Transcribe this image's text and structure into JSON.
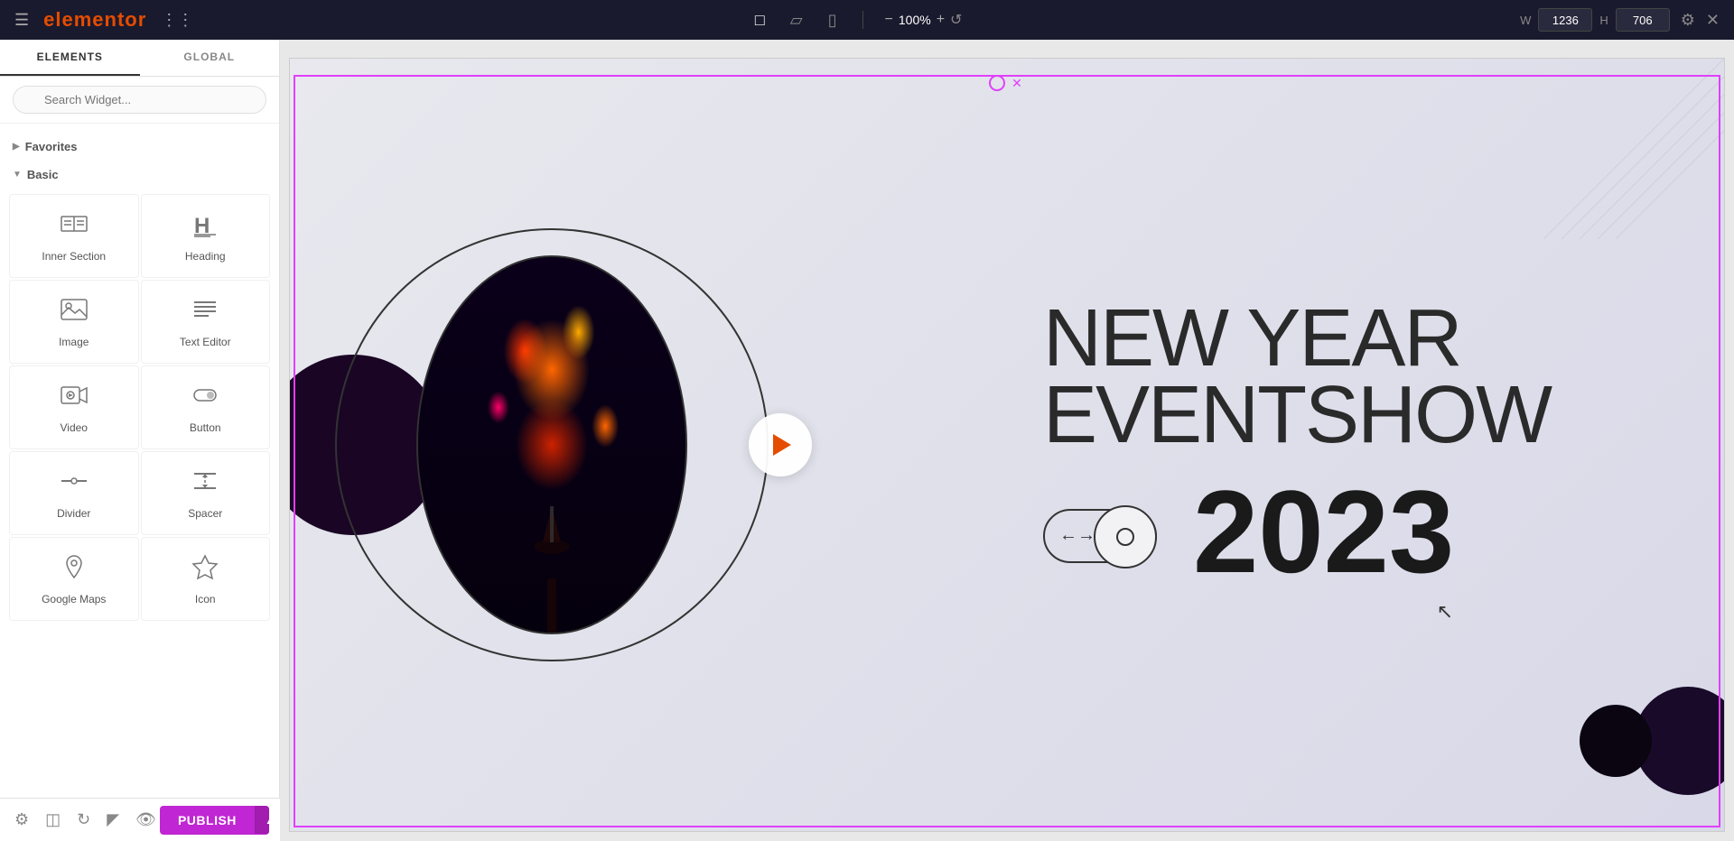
{
  "toolbar": {
    "logo": "elementor",
    "zoom_value": "100%",
    "zoom_minus": "−",
    "zoom_plus": "+",
    "width_label": "W",
    "height_label": "H",
    "width_value": "1236",
    "height_value": "706",
    "device_desktop": "desktop",
    "device_tablet": "tablet",
    "device_mobile": "mobile"
  },
  "sidebar": {
    "tab_elements": "ELEMENTS",
    "tab_global": "GLOBAL",
    "search_placeholder": "Search Widget...",
    "categories": {
      "favorites": {
        "label": "Favorites",
        "collapsed": true
      },
      "basic": {
        "label": "Basic",
        "collapsed": false
      }
    },
    "widgets": [
      {
        "id": "inner-section",
        "label": "Inner Section",
        "icon": "inner-section-icon"
      },
      {
        "id": "heading",
        "label": "Heading",
        "icon": "heading-icon"
      },
      {
        "id": "image",
        "label": "Image",
        "icon": "image-icon"
      },
      {
        "id": "text-editor",
        "label": "Text Editor",
        "icon": "text-editor-icon"
      },
      {
        "id": "video",
        "label": "Video",
        "icon": "video-icon"
      },
      {
        "id": "button",
        "label": "Button",
        "icon": "button-icon"
      },
      {
        "id": "divider",
        "label": "Divider",
        "icon": "divider-icon"
      },
      {
        "id": "spacer",
        "label": "Spacer",
        "icon": "spacer-icon"
      },
      {
        "id": "google-maps",
        "label": "Google Maps",
        "icon": "maps-icon"
      },
      {
        "id": "icon",
        "label": "Icon",
        "icon": "icon-icon"
      }
    ]
  },
  "canvas": {
    "event_title_line1": "NEW YEAR",
    "event_title_line2": "EVENTSHOW",
    "year": "2023"
  },
  "bottom_bar": {
    "publish_label": "PUBLISH"
  }
}
